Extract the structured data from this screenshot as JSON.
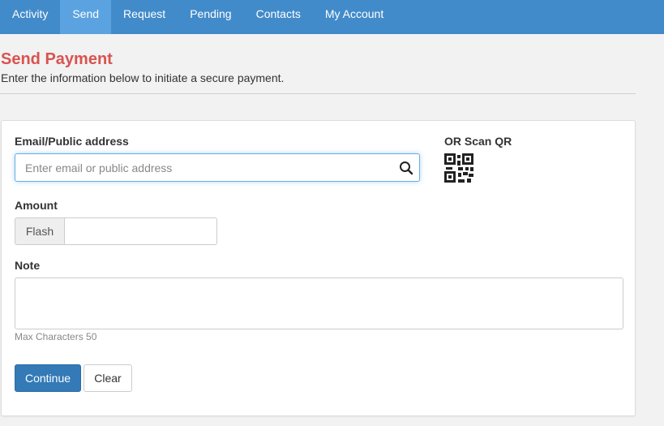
{
  "nav": {
    "items": [
      {
        "label": "Activity",
        "active": false
      },
      {
        "label": "Send",
        "active": true
      },
      {
        "label": "Request",
        "active": false
      },
      {
        "label": "Pending",
        "active": false
      },
      {
        "label": "Contacts",
        "active": false
      },
      {
        "label": "My Account",
        "active": false
      }
    ]
  },
  "page": {
    "title": "Send Payment",
    "subtitle": "Enter the information below to initiate a secure payment."
  },
  "form": {
    "email_label": "Email/Public address",
    "email_placeholder": "Enter email or public address",
    "email_value": "",
    "qr_label": "OR Scan QR",
    "amount_label": "Amount",
    "amount_addon": "Flash",
    "amount_value": "",
    "note_label": "Note",
    "note_value": "",
    "note_help": "Max Characters 50",
    "continue_label": "Continue",
    "clear_label": "Clear"
  },
  "icons": {
    "search": "search-icon",
    "qr": "qr-code-icon"
  },
  "colors": {
    "nav_bg": "#428bca",
    "nav_active": "#5aa3e0",
    "title": "#d9534f",
    "primary_button": "#337ab7"
  }
}
